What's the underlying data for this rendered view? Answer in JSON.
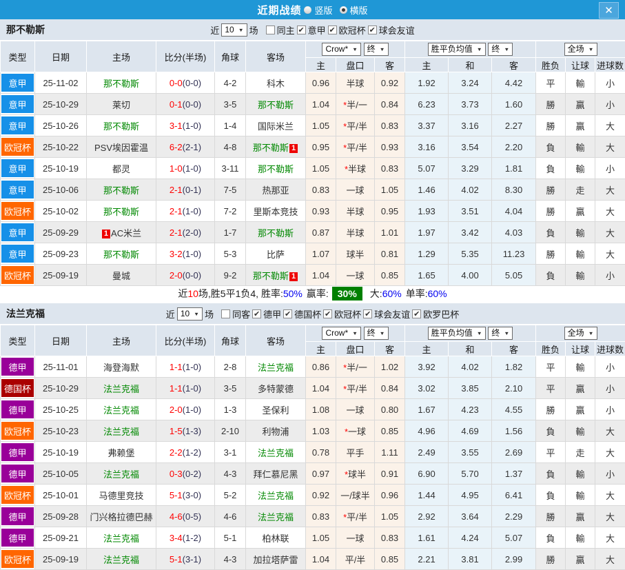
{
  "titlebar": {
    "title": "近期战绩",
    "radios": [
      {
        "label": "竖版",
        "selected": false
      },
      {
        "label": "横版",
        "selected": true
      }
    ],
    "close_label": "✕"
  },
  "colors": {
    "titlebar_bg": "#1f97d6",
    "league": {
      "意甲": "#1690e8",
      "欧冠杯": "#ff6600",
      "德甲": "#990099",
      "德国杯": "#aa0000"
    },
    "team_green": "#008800",
    "score_red": "#ff0000",
    "half_score_dark": "#333355",
    "result_red": "#e60000",
    "result_green": "#008800",
    "result_blue": "#1414cc",
    "win_badge_bg": "#008000",
    "odds_company_col_bg": "#fbf2e9",
    "avg_col_bg": "#e9f3f9"
  },
  "table_header": {
    "cols": [
      "类型",
      "日期",
      "主场",
      "比分(半场)",
      "角球",
      "客场"
    ],
    "group1_select": "Crow*",
    "group1_final": "终",
    "group1_cols": [
      "主",
      "盘口",
      "客"
    ],
    "group2_select": "胜平负均值",
    "group2_final": "终",
    "group2_cols": [
      "主",
      "和",
      "客"
    ],
    "group3_select": "全场",
    "group3_cols": [
      "胜负",
      "让球",
      "进球数"
    ]
  },
  "sections": [
    {
      "team": "那不勒斯",
      "filter": {
        "near": "近",
        "count": "10",
        "games": "场",
        "same": {
          "label": "同主",
          "checked": false
        },
        "leagues": [
          {
            "label": "意甲",
            "checked": true
          },
          {
            "label": "欧冠杯",
            "checked": true
          },
          {
            "label": "球会友谊",
            "checked": true
          }
        ]
      },
      "rows": [
        {
          "lg": "意甲",
          "date": "25-11-02",
          "home": {
            "t": "那不勒斯",
            "g": true
          },
          "s": "0-0",
          "h": "(0-0)",
          "cn": "4-2",
          "away": {
            "t": "科木"
          },
          "o1": "0.96",
          "hc": "半球",
          "o2": "0.92",
          "a1": "1.92",
          "a2": "3.24",
          "a3": "4.42",
          "r": "平",
          "hr": "輸",
          "gl": "小"
        },
        {
          "lg": "意甲",
          "date": "25-10-29",
          "home": {
            "t": "莱切"
          },
          "s": "0-1",
          "h": "(0-0)",
          "cn": "3-5",
          "away": {
            "t": "那不勒斯",
            "g": true
          },
          "o1": "1.04",
          "hc": "*半/一",
          "o2": "0.84",
          "a1": "6.23",
          "a2": "3.73",
          "a3": "1.60",
          "r": "勝",
          "hr": "贏",
          "gl": "小"
        },
        {
          "lg": "意甲",
          "date": "25-10-26",
          "home": {
            "t": "那不勒斯",
            "g": true
          },
          "s": "3-1",
          "h": "(1-0)",
          "cn": "1-4",
          "away": {
            "t": "国际米兰"
          },
          "o1": "1.05",
          "hc": "*平/半",
          "o2": "0.83",
          "a1": "3.37",
          "a2": "3.16",
          "a3": "2.27",
          "r": "勝",
          "hr": "贏",
          "gl": "大"
        },
        {
          "lg": "欧冠杯",
          "date": "25-10-22",
          "home": {
            "t": "PSV埃因霍温"
          },
          "s": "6-2",
          "h": "(2-1)",
          "cn": "4-8",
          "away": {
            "t": "那不勒斯",
            "g": true,
            "b": "1",
            "bp": "post"
          },
          "o1": "0.95",
          "hc": "*平/半",
          "o2": "0.93",
          "a1": "3.16",
          "a2": "3.54",
          "a3": "2.20",
          "r": "負",
          "hr": "輸",
          "gl": "大"
        },
        {
          "lg": "意甲",
          "date": "25-10-19",
          "home": {
            "t": "都灵"
          },
          "s": "1-0",
          "h": "(1-0)",
          "cn": "3-11",
          "away": {
            "t": "那不勒斯",
            "g": true
          },
          "o1": "1.05",
          "hc": "*半球",
          "o2": "0.83",
          "a1": "5.07",
          "a2": "3.29",
          "a3": "1.81",
          "r": "負",
          "hr": "輸",
          "gl": "小"
        },
        {
          "lg": "意甲",
          "date": "25-10-06",
          "home": {
            "t": "那不勒斯",
            "g": true
          },
          "s": "2-1",
          "h": "(0-1)",
          "cn": "7-5",
          "away": {
            "t": "热那亚"
          },
          "o1": "0.83",
          "hc": "一球",
          "o2": "1.05",
          "a1": "1.46",
          "a2": "4.02",
          "a3": "8.30",
          "r": "勝",
          "hr": "走",
          "gl": "大"
        },
        {
          "lg": "欧冠杯",
          "date": "25-10-02",
          "home": {
            "t": "那不勒斯",
            "g": true
          },
          "s": "2-1",
          "h": "(1-0)",
          "cn": "7-2",
          "away": {
            "t": "里斯本竞技"
          },
          "o1": "0.93",
          "hc": "半球",
          "o2": "0.95",
          "a1": "1.93",
          "a2": "3.51",
          "a3": "4.04",
          "r": "勝",
          "hr": "贏",
          "gl": "大"
        },
        {
          "lg": "意甲",
          "date": "25-09-29",
          "home": {
            "t": "AC米兰",
            "b": "1",
            "bp": "pre"
          },
          "s": "2-1",
          "h": "(2-0)",
          "cn": "1-7",
          "away": {
            "t": "那不勒斯",
            "g": true
          },
          "o1": "0.87",
          "hc": "半球",
          "o2": "1.01",
          "a1": "1.97",
          "a2": "3.42",
          "a3": "4.03",
          "r": "負",
          "hr": "輸",
          "gl": "大"
        },
        {
          "lg": "意甲",
          "date": "25-09-23",
          "home": {
            "t": "那不勒斯",
            "g": true
          },
          "s": "3-2",
          "h": "(1-0)",
          "cn": "5-3",
          "away": {
            "t": "比萨"
          },
          "o1": "1.07",
          "hc": "球半",
          "o2": "0.81",
          "a1": "1.29",
          "a2": "5.35",
          "a3": "11.23",
          "r": "勝",
          "hr": "輸",
          "gl": "大"
        },
        {
          "lg": "欧冠杯",
          "date": "25-09-19",
          "home": {
            "t": "曼城"
          },
          "s": "2-0",
          "h": "(0-0)",
          "cn": "9-2",
          "away": {
            "t": "那不勒斯",
            "g": true,
            "b": "1",
            "bp": "post"
          },
          "o1": "1.04",
          "hc": "一球",
          "o2": "0.85",
          "a1": "1.65",
          "a2": "4.00",
          "a3": "5.05",
          "r": "負",
          "hr": "輸",
          "gl": "小"
        }
      ],
      "summary": {
        "prefix": "近",
        "count": "10",
        "mid": "场,胜5平1负4, 胜率:",
        "win_rate": "50%",
        "label2": "赢率:",
        "win_badge": "30%",
        "label3": "大:",
        "big_rate": "60%",
        "label4": "单率:",
        "single_rate": "60%"
      }
    },
    {
      "team": "法兰克福",
      "filter": {
        "near": "近",
        "count": "10",
        "games": "场",
        "same": {
          "label": "同客",
          "checked": false
        },
        "leagues": [
          {
            "label": "德甲",
            "checked": true
          },
          {
            "label": "德国杯",
            "checked": true
          },
          {
            "label": "欧冠杯",
            "checked": true
          },
          {
            "label": "球会友谊",
            "checked": true
          },
          {
            "label": "欧罗巴杯",
            "checked": true
          }
        ]
      },
      "rows": [
        {
          "lg": "德甲",
          "date": "25-11-01",
          "home": {
            "t": "海登海默"
          },
          "s": "1-1",
          "h": "(1-0)",
          "cn": "2-8",
          "away": {
            "t": "法兰克福",
            "g": true
          },
          "o1": "0.86",
          "hc": "*半/一",
          "o2": "1.02",
          "a1": "3.92",
          "a2": "4.02",
          "a3": "1.82",
          "r": "平",
          "hr": "輸",
          "gl": "小"
        },
        {
          "lg": "德国杯",
          "date": "25-10-29",
          "home": {
            "t": "法兰克福",
            "g": true
          },
          "s": "1-1",
          "h": "(1-0)",
          "cn": "3-5",
          "away": {
            "t": "多特蒙德"
          },
          "o1": "1.04",
          "hc": "*平/半",
          "o2": "0.84",
          "a1": "3.02",
          "a2": "3.85",
          "a3": "2.10",
          "r": "平",
          "hr": "贏",
          "gl": "小"
        },
        {
          "lg": "德甲",
          "date": "25-10-25",
          "home": {
            "t": "法兰克福",
            "g": true
          },
          "s": "2-0",
          "h": "(1-0)",
          "cn": "1-3",
          "away": {
            "t": "圣保利"
          },
          "o1": "1.08",
          "hc": "一球",
          "o2": "0.80",
          "a1": "1.67",
          "a2": "4.23",
          "a3": "4.55",
          "r": "勝",
          "hr": "贏",
          "gl": "小"
        },
        {
          "lg": "欧冠杯",
          "date": "25-10-23",
          "home": {
            "t": "法兰克福",
            "g": true
          },
          "s": "1-5",
          "h": "(1-3)",
          "cn": "2-10",
          "away": {
            "t": "利物浦"
          },
          "o1": "1.03",
          "hc": "*一球",
          "o2": "0.85",
          "a1": "4.96",
          "a2": "4.69",
          "a3": "1.56",
          "r": "負",
          "hr": "輸",
          "gl": "大"
        },
        {
          "lg": "德甲",
          "date": "25-10-19",
          "home": {
            "t": "弗赖堡"
          },
          "s": "2-2",
          "h": "(1-2)",
          "cn": "3-1",
          "away": {
            "t": "法兰克福",
            "g": true
          },
          "o1": "0.78",
          "hc": "平手",
          "o2": "1.11",
          "a1": "2.49",
          "a2": "3.55",
          "a3": "2.69",
          "r": "平",
          "hr": "走",
          "gl": "大"
        },
        {
          "lg": "德甲",
          "date": "25-10-05",
          "home": {
            "t": "法兰克福",
            "g": true
          },
          "s": "0-3",
          "h": "(0-2)",
          "cn": "4-3",
          "away": {
            "t": "拜仁慕尼黑"
          },
          "o1": "0.97",
          "hc": "*球半",
          "o2": "0.91",
          "a1": "6.90",
          "a2": "5.70",
          "a3": "1.37",
          "r": "負",
          "hr": "輸",
          "gl": "小"
        },
        {
          "lg": "欧冠杯",
          "date": "25-10-01",
          "home": {
            "t": "马德里竞技"
          },
          "s": "5-1",
          "h": "(3-0)",
          "cn": "5-2",
          "away": {
            "t": "法兰克福",
            "g": true
          },
          "o1": "0.92",
          "hc": "一/球半",
          "o2": "0.96",
          "a1": "1.44",
          "a2": "4.95",
          "a3": "6.41",
          "r": "負",
          "hr": "輸",
          "gl": "大"
        },
        {
          "lg": "德甲",
          "date": "25-09-28",
          "home": {
            "t": "门兴格拉德巴赫"
          },
          "s": "4-6",
          "h": "(0-5)",
          "cn": "4-6",
          "away": {
            "t": "法兰克福",
            "g": true
          },
          "o1": "0.83",
          "hc": "*平/半",
          "o2": "1.05",
          "a1": "2.92",
          "a2": "3.64",
          "a3": "2.29",
          "r": "勝",
          "hr": "贏",
          "gl": "大"
        },
        {
          "lg": "德甲",
          "date": "25-09-21",
          "home": {
            "t": "法兰克福",
            "g": true
          },
          "s": "3-4",
          "h": "(1-2)",
          "cn": "5-1",
          "away": {
            "t": "柏林联"
          },
          "o1": "1.05",
          "hc": "一球",
          "o2": "0.83",
          "a1": "1.61",
          "a2": "4.24",
          "a3": "5.07",
          "r": "負",
          "hr": "輸",
          "gl": "大"
        },
        {
          "lg": "欧冠杯",
          "date": "25-09-19",
          "home": {
            "t": "法兰克福",
            "g": true
          },
          "s": "5-1",
          "h": "(3-1)",
          "cn": "4-3",
          "away": {
            "t": "加拉塔萨雷"
          },
          "o1": "1.04",
          "hc": "平/半",
          "o2": "0.85",
          "a1": "2.21",
          "a2": "3.81",
          "a3": "2.99",
          "r": "勝",
          "hr": "贏",
          "gl": "大"
        }
      ]
    }
  ]
}
